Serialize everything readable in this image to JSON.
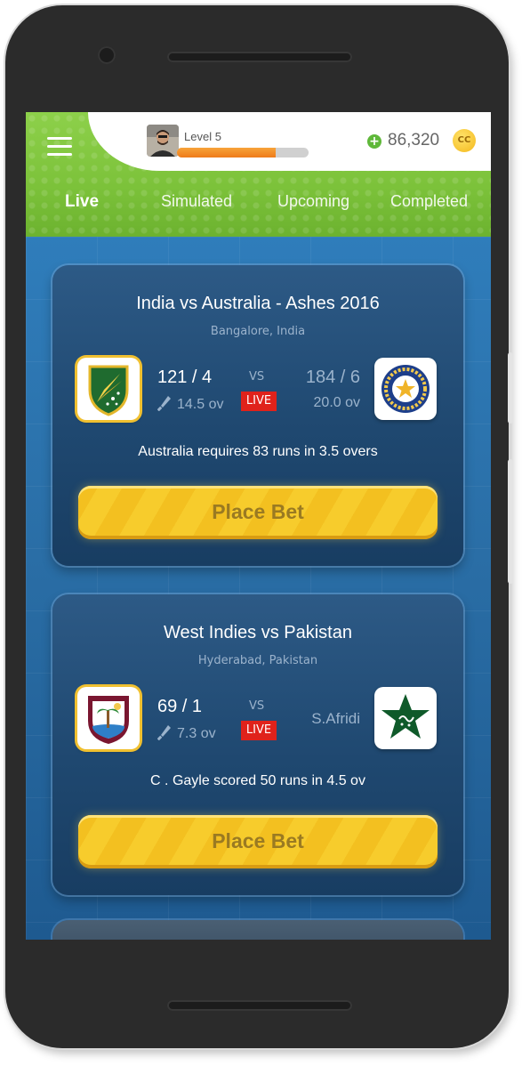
{
  "header": {
    "level": "Level 5",
    "xp_progress": 0.75,
    "coins": "86,320",
    "coin_symbol": "CC"
  },
  "tabs": [
    {
      "label": "Live",
      "active": true
    },
    {
      "label": "Simulated",
      "active": false
    },
    {
      "label": "Upcoming",
      "active": false
    },
    {
      "label": "Completed",
      "active": false
    }
  ],
  "matches": [
    {
      "title": "India vs Australia - Ashes 2016",
      "venue": "Bangalore, India",
      "left_logo": "australia-crest-icon",
      "left_score": "121 / 4",
      "left_overs": "14.5 ov",
      "vs": "VS",
      "live": "LIVE",
      "right_logo": "india-bcci-crest-icon",
      "right_score": "184 / 6",
      "right_overs": "20.0 ov",
      "status": "Australia requires 83 runs in 3.5 overs",
      "bet_label": "Place Bet"
    },
    {
      "title": "West Indies vs Pakistan",
      "venue": "Hyderabad, Pakistan",
      "left_logo": "west-indies-crest-icon",
      "left_score": "69 / 1",
      "left_overs": "7.3 ov",
      "vs": "VS",
      "live": "LIVE",
      "right_logo": "pakistan-star-crest-icon",
      "right_player": "S.Afridi",
      "status": "C . Gayle scored 50 runs in 4.5 ov",
      "bet_label": "Place Bet"
    }
  ],
  "colors": {
    "header_green": "#7cc23a",
    "card_navy": "#1f4870",
    "button_yellow": "#f7cc2c",
    "live_red": "#e0221b",
    "xp_orange": "#ee7b1a"
  }
}
